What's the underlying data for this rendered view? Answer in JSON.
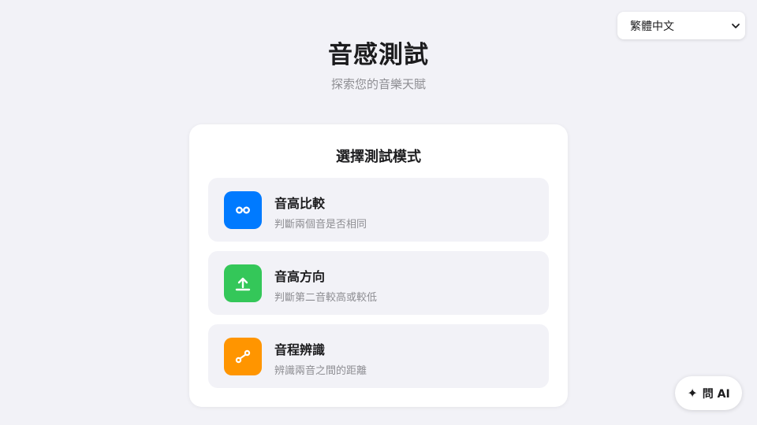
{
  "language_select": {
    "value": "繁體中文"
  },
  "header": {
    "title": "音感測試",
    "subtitle": "探索您的音樂天賦"
  },
  "card": {
    "title": "選擇測試模式",
    "modes": [
      {
        "label": "音高比較",
        "description": "判斷兩個音是否相同",
        "icon": "infinity-icon",
        "color": "#007aff"
      },
      {
        "label": "音高方向",
        "description": "判斷第二音較高或較低",
        "icon": "upload-arrow-icon",
        "color": "#34c759"
      },
      {
        "label": "音程辨識",
        "description": "辨識兩音之間的距離",
        "icon": "interval-link-icon",
        "color": "#ff9500"
      }
    ]
  },
  "ask_ai": {
    "label": "問 AI",
    "icon": "sparkle-icon"
  }
}
